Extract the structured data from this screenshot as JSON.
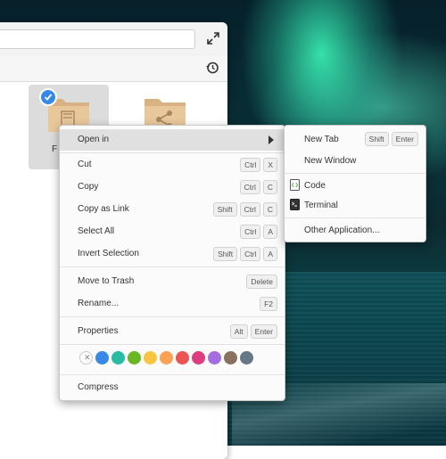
{
  "desktop": {
    "wallpaper": "aurora-over-sea"
  },
  "window": {
    "folders": [
      {
        "name": "F",
        "icon": "documents-folder-icon",
        "selected": true
      },
      {
        "name": "",
        "icon": "shared-folder-icon",
        "selected": false
      }
    ]
  },
  "context_menu": {
    "open_in": "Open in",
    "items": [
      {
        "label": "Cut",
        "keys": [
          "Ctrl",
          "X"
        ]
      },
      {
        "label": "Copy",
        "keys": [
          "Ctrl",
          "C"
        ]
      },
      {
        "label": "Copy as Link",
        "keys": [
          "Shift",
          "Ctrl",
          "C"
        ]
      },
      {
        "label": "Select All",
        "keys": [
          "Ctrl",
          "A"
        ]
      },
      {
        "label": "Invert Selection",
        "keys": [
          "Shift",
          "Ctrl",
          "A"
        ]
      },
      {
        "label": "Move to Trash",
        "keys": [
          "Delete"
        ]
      },
      {
        "label": "Rename...",
        "keys": [
          "F2"
        ]
      },
      {
        "label": "Properties",
        "keys": [
          "Alt",
          "Enter"
        ]
      }
    ],
    "colors": [
      "#3689e6",
      "#28bca3",
      "#68b723",
      "#f9c440",
      "#ffa154",
      "#ed5353",
      "#de3e80",
      "#a56de2",
      "#8a715e",
      "#667885"
    ],
    "compress": "Compress"
  },
  "submenu": {
    "new_tab": "New Tab",
    "new_tab_keys": [
      "Shift",
      "Enter"
    ],
    "new_window": "New Window",
    "code": "Code",
    "terminal": "Terminal",
    "other": "Other Application..."
  }
}
